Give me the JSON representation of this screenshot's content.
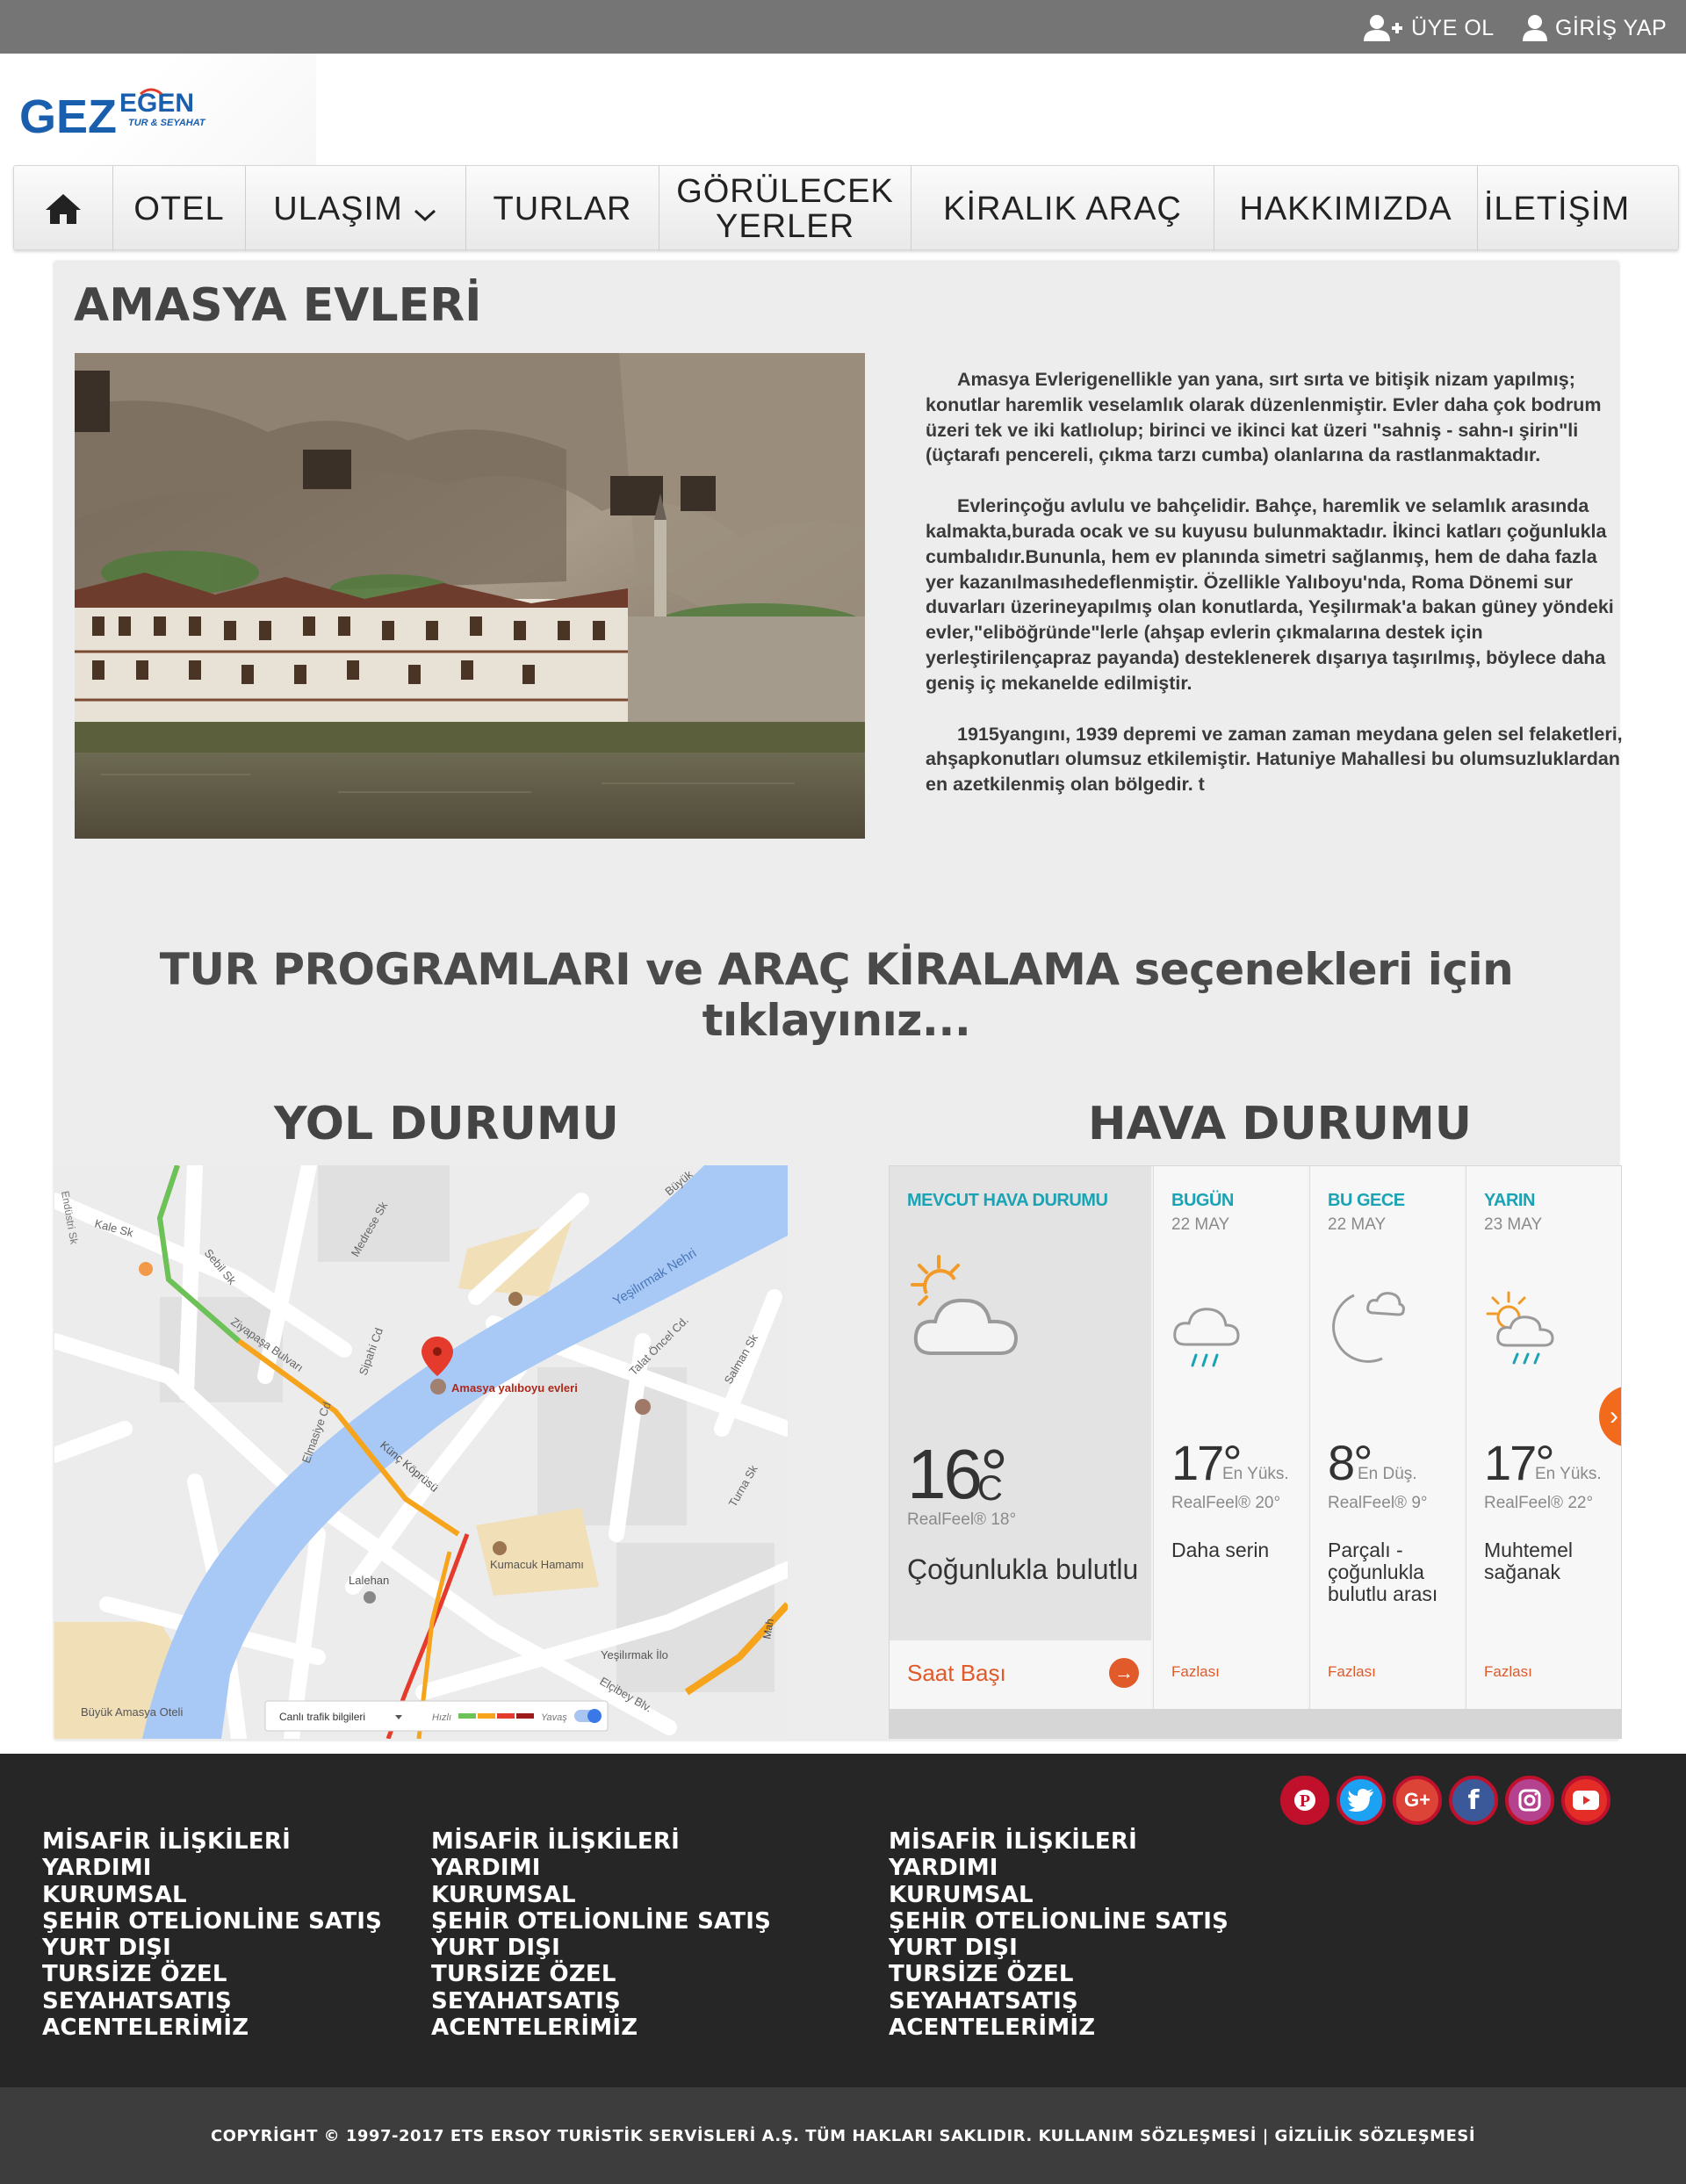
{
  "topbar": {
    "register_label": "ÜYE OL",
    "login_label": "GİRİŞ YAP"
  },
  "logo": {
    "text_main": "GEZ",
    "text_brand": "EGEN",
    "tagline": "TUR & SEYAHAT"
  },
  "nav": {
    "items": [
      "OTEL",
      "ULAŞIM",
      "TURLAR",
      "GÖRÜLECEK YERLER",
      "KİRALIK ARAÇ",
      "HAKKIMIZDA",
      "İLETİŞİM"
    ]
  },
  "page": {
    "title": "AMASYA EVLERİ",
    "paragraphs": [
      "Amasya Evlerigenellikle yan yana, sırt sırta ve bitişik nizam yapılmış; konutlar haremlik veselamlık olarak düzenlenmiştir. Evler daha çok bodrum üzeri tek ve iki katlıolup; birinci ve ikinci kat üzeri \"sahniş - sahn-ı şirin\"li (üçtarafı pencereli, çıkma tarzı cumba) olanlarına da rastlanmaktadır.",
      "Evlerinçoğu avlulu ve bahçelidir. Bahçe, haremlik ve selamlık arasında kalmakta,burada ocak ve su kuyusu bulunmaktadır. İkinci katları çoğunlukla cumbalıdır.Bununla, hem ev planında simetri sağlanmış, hem de daha fazla yer kazanılmasıhedeflenmiştir. Özellikle Yalıboyu'nda, Roma Dönemi sur duvarları üzerineyapılmış olan konutlarda, Yeşilırmak'a bakan güney yöndeki evler,\"eliböğründe\"lerle (ahşap evlerin çıkmalarına destek için yerleştirilençapraz payanda) desteklenerek dışarıya taşırılmış, böylece daha geniş iç mekanelde edilmiştir.",
      "1915yangını, 1939 depremi ve zaman zaman meydana gelen sel felaketleri, ahşapkonutları olumsuz etkilemiştir. Hatuniye Mahallesi bu olumsuzluklardan en azetkilenmiş olan bölgedir. t"
    ],
    "cta": "TUR PROGRAMLARI ve ARAÇ KİRALAMA seçenekleri için tıklayınız..."
  },
  "road": {
    "title": "YOL DURUMU",
    "labels": {
      "place": "Amasya yalıboyu evleri",
      "river": "Yeşilırmak Nehri",
      "hamam": "Kumacuk Hamamı",
      "lalehan": "Lalehan",
      "hotel": "Büyük Amasya Oteli",
      "school": "Yeşilırmak İlo",
      "kale": "Kale Sk",
      "sebil": "Sebil Sk",
      "medrese": "Medrese Sk",
      "talat": "Talat Öncel Cd.",
      "salman": "Salman Sk",
      "turna": "Turna Sk",
      "elmasiye": "Elmasiye Cd",
      "sipahi": "Sipahi Cd",
      "ziya": "Ziyapaşa Bulvarı",
      "kunc": "Künç Köprüsü",
      "buyuk": "Büyük",
      "endustri": "Endüstri Sk",
      "elcibey": "Elçibey Blv.",
      "traffic": "Canlı trafik bilgileri",
      "fast": "Hızlı",
      "slow": "Yavaş",
      "mah": "Mah"
    }
  },
  "weather": {
    "title": "HAVA DURUMU",
    "current": {
      "head": "MEVCUT HAVA DURUMU",
      "temp": "16°",
      "unit": "C",
      "realfeel": "RealFeel® 18°",
      "desc": "Çoğunlukla bulutlu",
      "hourly": "Saat Başı"
    },
    "days": [
      {
        "head": "BUGÜN",
        "date": "22 MAY",
        "temp": "17°",
        "kind": "En Yüks.",
        "realfeel": "RealFeel® 20°",
        "desc": "Daha serin",
        "more": "Fazlası"
      },
      {
        "head": "BU GECE",
        "date": "22 MAY",
        "temp": "8°",
        "kind": "En Düş.",
        "realfeel": "RealFeel® 9°",
        "desc": "Parçalı - çoğunlukla bulutlu arası",
        "more": "Fazlası"
      },
      {
        "head": "YARIN",
        "date": "23 MAY",
        "temp": "17°",
        "kind": "En Yüks.",
        "realfeel": "RealFeel® 22°",
        "desc": "Muhtemel sağanak",
        "more": "Fazlası"
      }
    ]
  },
  "footer": {
    "columns": [
      [
        "MİSAFİR İLİŞKİLERİ",
        "YARDIMI",
        "KURUMSAL",
        "ŞEHİR OTELİONLİNE SATIŞ",
        "YURT DIŞI",
        "TURSİZE ÖZEL",
        "SEYAHATSATIŞ",
        "ACENTELERİMİZ"
      ],
      [
        "MİSAFİR İLİŞKİLERİ",
        "YARDIMI",
        "KURUMSAL",
        "ŞEHİR OTELİONLİNE SATIŞ",
        "YURT DIŞI",
        "TURSİZE ÖZEL",
        "SEYAHATSATIŞ",
        "ACENTELERİMİZ"
      ],
      [
        "MİSAFİR İLİŞKİLERİ",
        "YARDIMI",
        "KURUMSAL",
        "ŞEHİR OTELİONLİNE SATIŞ",
        "YURT DIŞI",
        "TURSİZE ÖZEL",
        "SEYAHATSATIŞ",
        "ACENTELERİMİZ"
      ]
    ],
    "social": [
      "pinterest-icon",
      "twitter-icon",
      "google-plus-icon",
      "facebook-icon",
      "instagram-icon",
      "youtube-icon"
    ],
    "copyright": "COPYRİGHT © 1997-2017 ETS ERSOY TURİSTİK SERVİSLERİ A.Ş. TÜM HAKLARI SAKLIDIR. KULLANIM SÖZLEŞMESİ | GİZLİLİK SÖZLEŞMESİ"
  },
  "colors": {
    "topbar": "#757575",
    "logo_blue": "#1a5fae",
    "footer_bg": "#262626",
    "copyright_bg": "#3d3d3d",
    "weather_accent": "#1aa3b4",
    "weather_orange": "#e05a2a"
  }
}
